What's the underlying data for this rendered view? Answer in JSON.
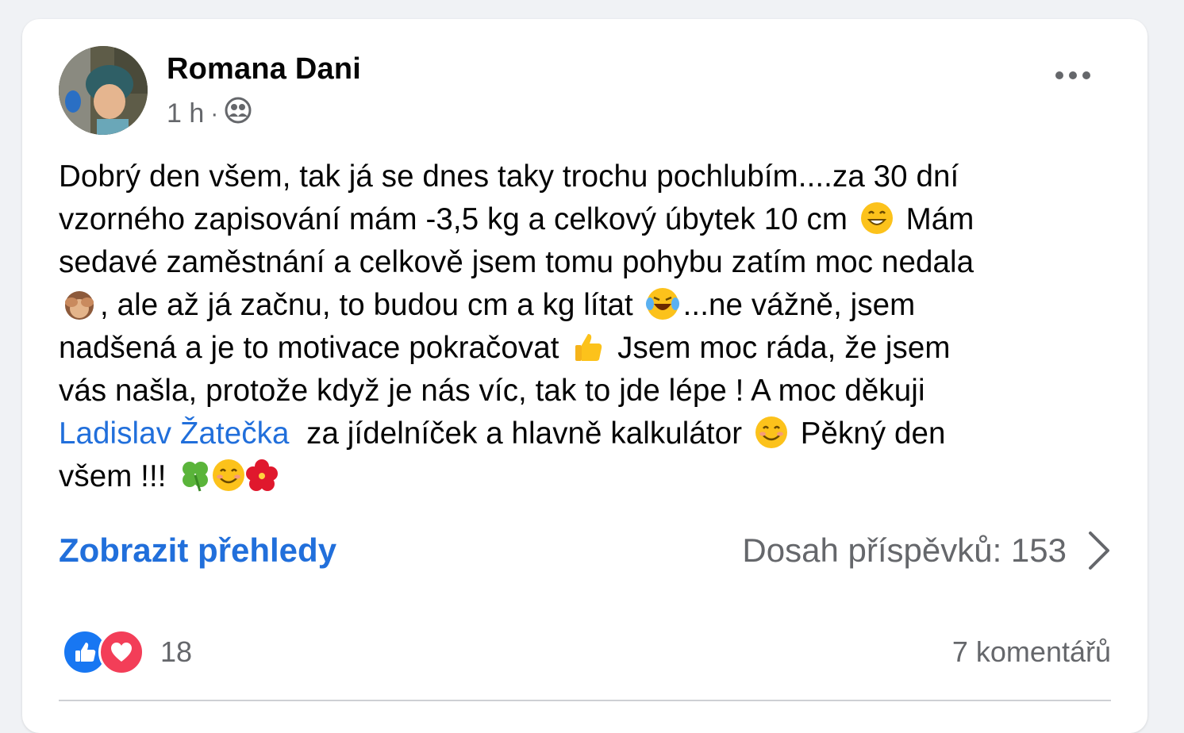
{
  "post": {
    "author": "Romana Dani",
    "time": "1 h",
    "audience_icon": "friends-icon",
    "text": {
      "l1": "Dobrý den všem, tak já se dnes taky trochu pochlubím....za 30 dní",
      "l2a": "vzorného zapisování mám -3,5 kg a celkový úbytek 10 cm",
      "l2b": "Mám",
      "l3": "sedavé zaměstnání a celkově jsem tomu pohybu zatím moc nedala",
      "l4a": ", ale až já začnu, to budou cm a kg lítat",
      "l4b": "...ne vážně, jsem",
      "l5a": "nadšená a je to motivace pokračovat",
      "l5b": "Jsem moc ráda, že jsem",
      "l6": "vás našla, protože když je nás víc, tak to jde lépe ! A moc děkuji",
      "mention": "Ladislav Žatečka",
      "l7a": "za jídelníček a hlavně kalkulátor",
      "l7b": "Pěkný den",
      "l8": "všem !!!"
    },
    "insights_label": "Zobrazit přehledy",
    "reach_label": "Dosah příspěvků: 153",
    "reactions_count": "18",
    "comments_label": "7 komentářů"
  },
  "colors": {
    "link": "#216fdb",
    "secondary_text": "#65676b",
    "like_blue": "#1877f2",
    "love_red": "#f33e58"
  }
}
